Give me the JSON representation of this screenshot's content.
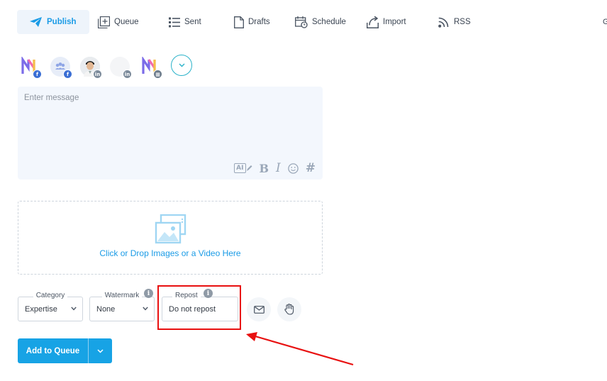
{
  "nav": {
    "publish": "Publish",
    "queue": "Queue",
    "sent": "Sent",
    "drafts": "Drafts",
    "schedule": "Schedule",
    "import": "Import",
    "rss": "RSS",
    "cut_off": "G"
  },
  "accounts": [
    {
      "icon": "brand-logo",
      "network": "facebook"
    },
    {
      "icon": "group-avatar",
      "network": "facebook"
    },
    {
      "icon": "user-photo",
      "network": "linkedin"
    },
    {
      "icon": "blank-avatar",
      "network": "linkedin"
    },
    {
      "icon": "brand-logo",
      "network": "google-business"
    }
  ],
  "message": {
    "placeholder": "Enter message",
    "tools": {
      "ai": "AI",
      "bold": "B",
      "italic": "I",
      "hash": "#"
    }
  },
  "media": {
    "drop_text": "Click or Drop Images or a Video Here"
  },
  "options": {
    "category": {
      "label": "Category",
      "value": "Expertise"
    },
    "watermark": {
      "label": "Watermark",
      "value": "None"
    },
    "repost": {
      "label": "Repost",
      "value": "Do not repost"
    }
  },
  "actions": {
    "add_to_queue": "Add to Queue"
  },
  "colors": {
    "accent": "#17a3e5",
    "annotation": "#e81010",
    "input_bg": "#f3f7fd"
  }
}
